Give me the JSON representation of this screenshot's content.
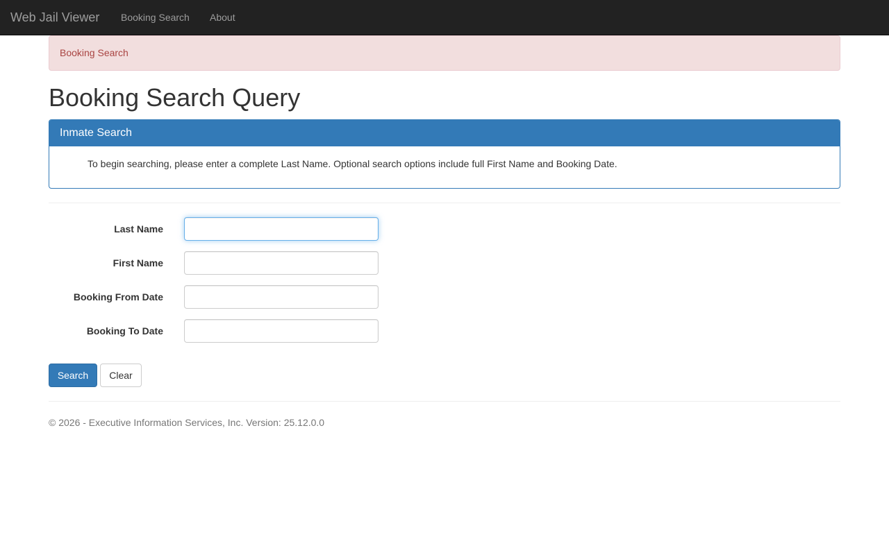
{
  "navbar": {
    "brand": "Web Jail Viewer",
    "links": [
      {
        "label": "Booking Search"
      },
      {
        "label": "About"
      }
    ]
  },
  "alert": {
    "text": "Booking Search"
  },
  "page": {
    "title": "Booking Search Query"
  },
  "panel": {
    "heading": "Inmate Search",
    "body": "To begin searching, please enter a complete Last Name. Optional search options include full First Name and Booking Date."
  },
  "form": {
    "fields": [
      {
        "label": "Last Name",
        "value": "",
        "focused": true
      },
      {
        "label": "First Name",
        "value": ""
      },
      {
        "label": "Booking From Date",
        "value": ""
      },
      {
        "label": "Booking To Date",
        "value": ""
      }
    ],
    "buttons": {
      "search": "Search",
      "clear": "Clear"
    }
  },
  "footer": {
    "text": "© 2026 - Executive Information Services, Inc. Version: 25.12.0.0"
  },
  "colors": {
    "navbar_bg": "#222222",
    "alert_bg": "#f2dede",
    "alert_text": "#a94442",
    "primary": "#337ab7"
  }
}
